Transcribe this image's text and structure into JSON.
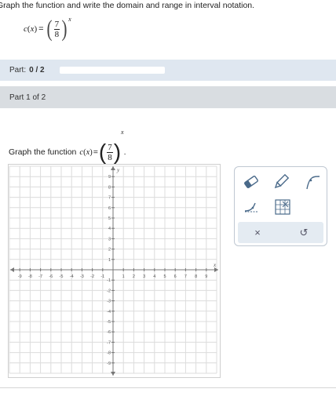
{
  "instruction": "Graph the function and write the domain and range in interval notation.",
  "formula": {
    "fname": "c",
    "var": "x",
    "open": "(",
    "close": ")",
    "equals": "=",
    "numerator": "7",
    "denominator": "8",
    "exponent": "x"
  },
  "part_bar": {
    "label": "Part:",
    "value": "0 / 2",
    "progress": 0
  },
  "part_header": "Part 1 of 2",
  "question": {
    "prefix": "Graph the function",
    "suffix": "."
  },
  "graph": {
    "x_axis_label": "x",
    "y_axis_label": "y",
    "x_min": -10,
    "x_max": 10,
    "y_min": -10,
    "y_max": 10,
    "x_ticks": [
      "-9",
      "-8",
      "-7",
      "-6",
      "-5",
      "-4",
      "-3",
      "-2",
      "-1",
      "1",
      "2",
      "3",
      "4",
      "5",
      "6",
      "7",
      "8",
      "9"
    ],
    "y_ticks": [
      "9",
      "8",
      "7",
      "6",
      "5",
      "4",
      "3",
      "2",
      "1",
      "-1",
      "-2",
      "-3",
      "-4",
      "-5",
      "-6",
      "-7",
      "-8",
      "-9"
    ]
  },
  "toolbox": {
    "tools": [
      "eraser-icon",
      "pencil-icon",
      "exponential-curve-icon",
      "asymptote-icon",
      "no-solution-grid-icon"
    ],
    "actions": {
      "clear": "×",
      "undo": "↺"
    },
    "colors": {
      "border": "#bfc8d2",
      "panel": "#e4ebf2",
      "icon": "#4a6a8a"
    }
  },
  "colors": {
    "part_bar": "#dfe7f0",
    "part_header": "#d9dde1"
  }
}
